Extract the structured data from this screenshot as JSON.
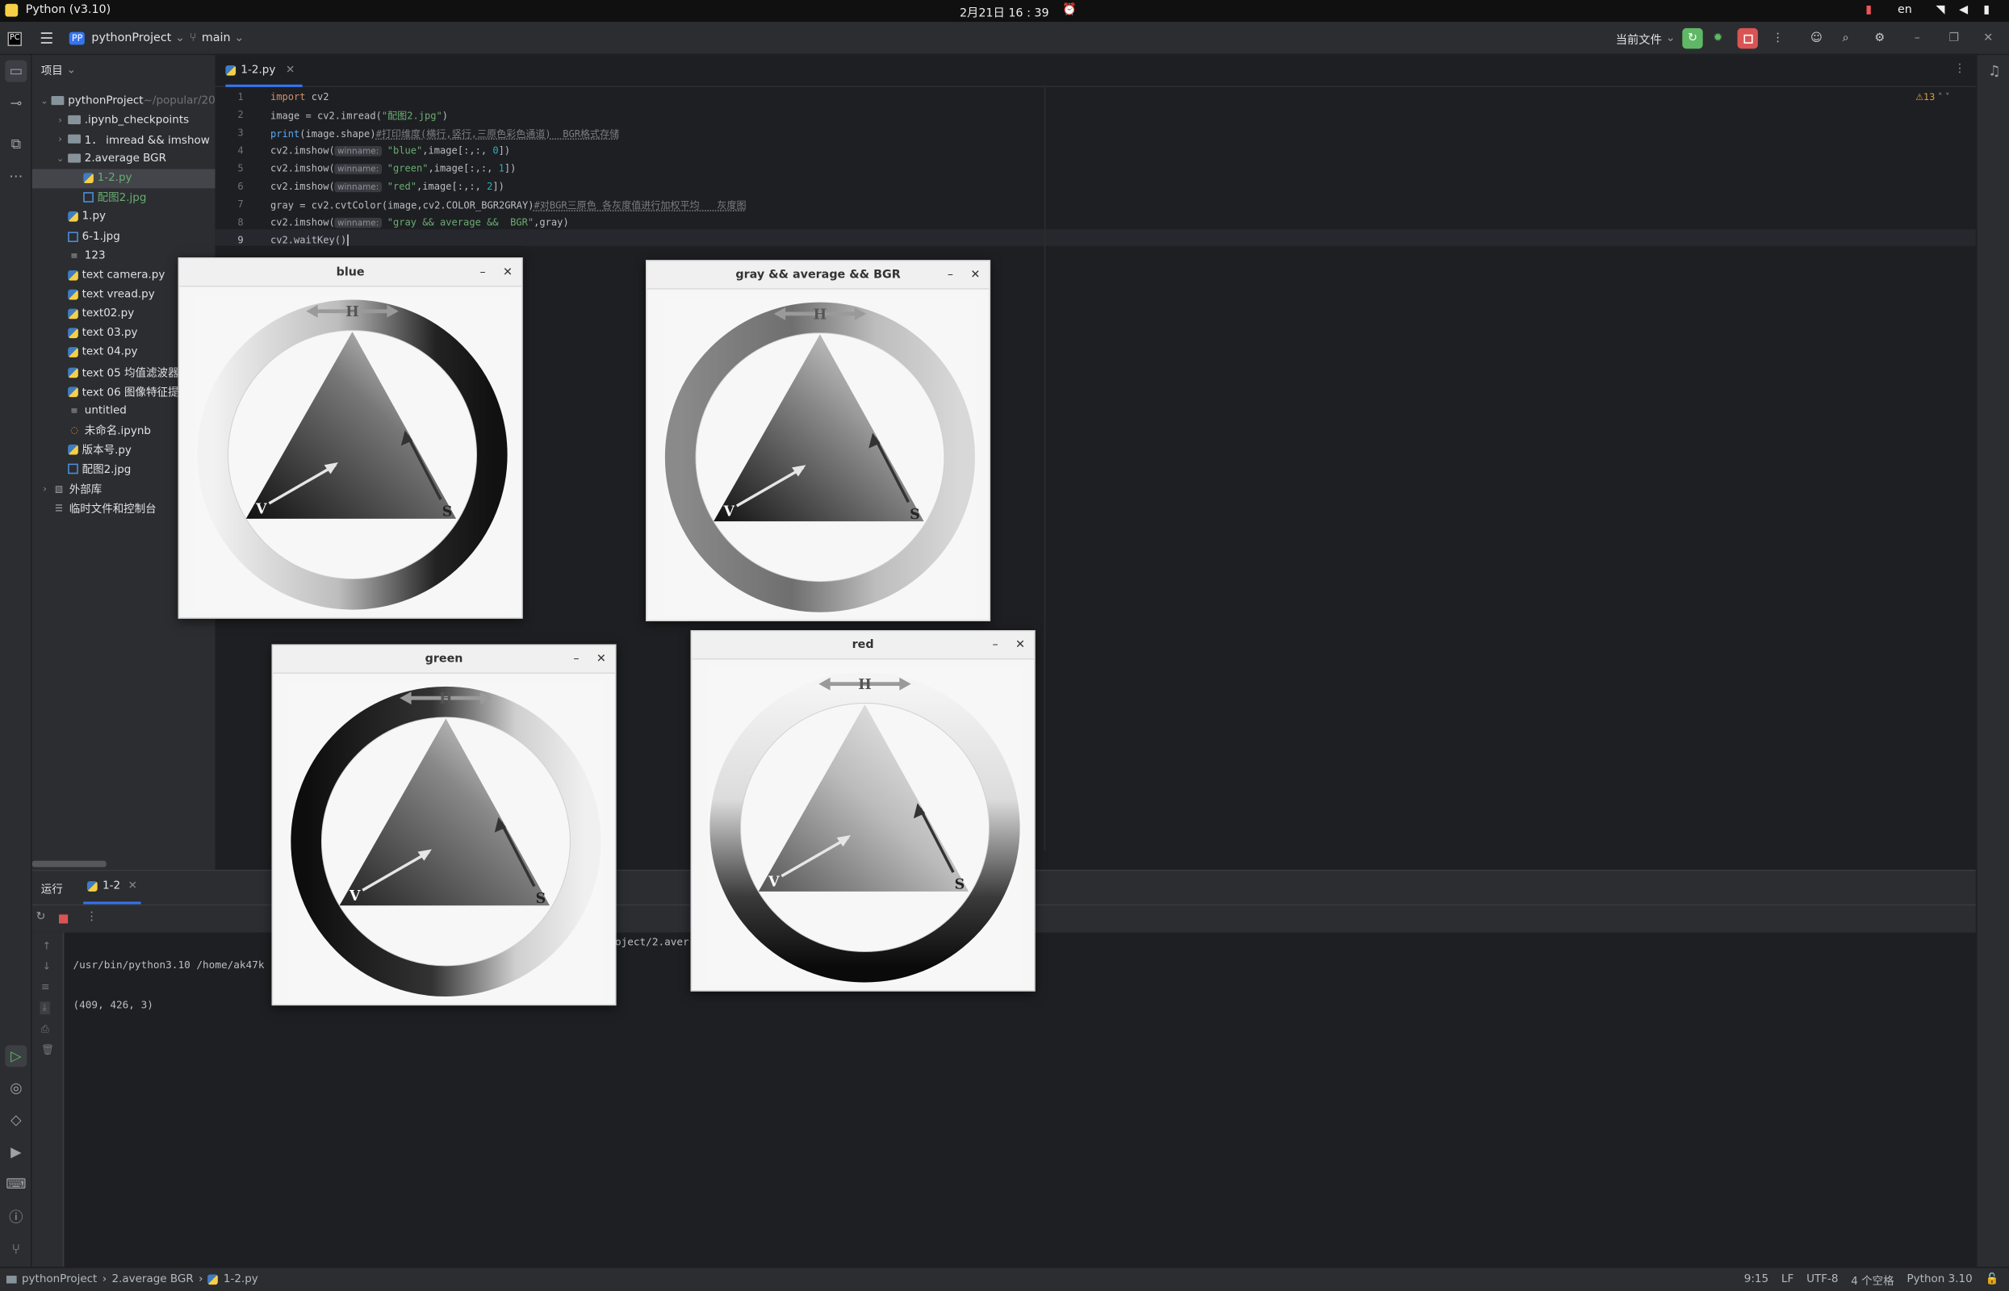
{
  "system": {
    "app": "Python (v3.10)",
    "clock": "2月21日 16 : 39",
    "lang": "en"
  },
  "header": {
    "project_badge": "PP",
    "project": "pythonProject",
    "branch": "main",
    "run_config": "当前文件"
  },
  "project_panel": {
    "title": "项目",
    "items": [
      {
        "label": "pythonProject",
        "suffix": "~/popular/20",
        "type": "folder",
        "depth": 0,
        "open": true
      },
      {
        "label": ".ipynb_checkpoints",
        "type": "folder",
        "depth": 1,
        "open": false
      },
      {
        "label": "1．  imread  && imshow",
        "type": "folder",
        "depth": 1,
        "open": false
      },
      {
        "label": "2.average BGR",
        "type": "folder",
        "depth": 1,
        "open": true
      },
      {
        "label": "1-2.py",
        "type": "py",
        "depth": 2,
        "selected": true
      },
      {
        "label": "配图2.jpg",
        "type": "img",
        "depth": 2
      },
      {
        "label": "1.py",
        "type": "py",
        "depth": 1
      },
      {
        "label": "6-1.jpg",
        "type": "img",
        "depth": 1
      },
      {
        "label": "123",
        "type": "txt",
        "depth": 1
      },
      {
        "label": "text camera.py",
        "type": "py",
        "depth": 1
      },
      {
        "label": "text vread.py",
        "type": "py",
        "depth": 1
      },
      {
        "label": "text02.py",
        "type": "py",
        "depth": 1
      },
      {
        "label": "text 03.py",
        "type": "py",
        "depth": 1
      },
      {
        "label": "text 04.py",
        "type": "py",
        "depth": 1
      },
      {
        "label": "text 05 均值滤波器",
        "type": "py",
        "depth": 1
      },
      {
        "label": "text 06 图像特征提",
        "type": "py",
        "depth": 1
      },
      {
        "label": "untitled",
        "type": "txt",
        "depth": 1
      },
      {
        "label": "未命名.ipynb",
        "type": "nb",
        "depth": 1
      },
      {
        "label": "版本号.py",
        "type": "py",
        "depth": 1
      },
      {
        "label": "配图2.jpg",
        "type": "img",
        "depth": 1
      },
      {
        "label": "外部库",
        "type": "lib",
        "depth": 0,
        "open": false
      },
      {
        "label": "临时文件和控制台",
        "type": "scratch",
        "depth": 0
      }
    ]
  },
  "editor": {
    "tab": "1-2.py",
    "warnings": "13",
    "lines": [
      "1",
      "2",
      "3",
      "4",
      "5",
      "6",
      "7",
      "8",
      "9"
    ],
    "code": {
      "l1a": "import",
      "l1b": " cv2",
      "l2a": "image = cv2.imread(",
      "l2b": "\"配图2.jpg\"",
      "l2c": ")",
      "l3a": "print",
      "l3b": "(image.shape)",
      "l3c": "#打印维度(横行,竖行,三原色彩色通道)  BGR格式存储",
      "l4a": "cv2.imshow(",
      "l4b": "\"blue\"",
      "l4c": ",image[:,:, ",
      "l4d": "0",
      "l4e": "])",
      "l5a": "cv2.imshow(",
      "l5b": "\"green\"",
      "l5c": ",image[:,:, ",
      "l5d": "1",
      "l5e": "])",
      "l6a": "cv2.imshow(",
      "l6b": "\"red\"",
      "l6c": ",image[:,:, ",
      "l6d": "2",
      "l6e": "])",
      "l7a": "gray = cv2.cvtColor(image,cv2.COLOR_BGR2GRAY)",
      "l7b": "#对BGR三原色 各灰度值进行加权平均   灰度图",
      "l8a": "cv2.imshow(",
      "l8b": "\"gray && average &&  BGR\"",
      "l8c": ",gray)",
      "l9a": "cv2.waitKey()",
      "hint": "winname:"
    }
  },
  "run": {
    "label": "运行",
    "tab": "1-2",
    "cmd_left": "/usr/bin/python3.10 /home/ak47k",
    "cmd_right": "oject/2.aver",
    "output": "(409, 426, 3)"
  },
  "status": {
    "crumb1": "pythonProject",
    "crumb2": "2.average BGR",
    "crumb3": "1-2.py",
    "pos": "9:15",
    "le": "LF",
    "enc": "UTF-8",
    "indent": "4 个空格",
    "interp": "Python 3.10"
  },
  "windows": {
    "blue": {
      "title": "blue",
      "min": "–",
      "close": "✕",
      "img": {
        "ring": "dark-right",
        "h": "H",
        "v": "V",
        "s": "S"
      }
    },
    "gray": {
      "title": "gray && average &&  BGR",
      "min": "–",
      "close": "✕",
      "img": {
        "ring": "gray",
        "h": "H",
        "v": "V",
        "s": "S"
      }
    },
    "green": {
      "title": "green",
      "min": "–",
      "close": "✕",
      "img": {
        "ring": "dark-left",
        "h": "H",
        "v": "V",
        "s": "S"
      }
    },
    "red": {
      "title": "red",
      "min": "–",
      "close": "✕",
      "img": {
        "ring": "dark-bottom",
        "h": "H",
        "v": "V",
        "s": "S"
      }
    }
  },
  "colors": {
    "accent": "#3574f0",
    "run_green": "#5fb865",
    "stop_red": "#d95454"
  }
}
